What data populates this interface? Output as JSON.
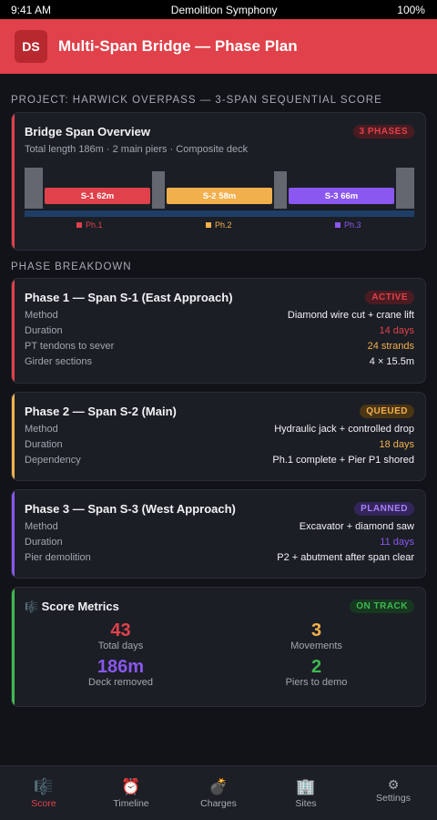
{
  "status": {
    "time": "9:41 AM",
    "app": "Demolition Symphony",
    "battery": "100%"
  },
  "header": {
    "logo": "DS",
    "title": "Multi-Span Bridge — Phase Plan"
  },
  "project_label": "PROJECT: HARWICK OVERPASS — 3-SPAN SEQUENTIAL SCORE",
  "overview": {
    "title": "Bridge Span Overview",
    "badge": "3 PHASES",
    "subtitle": "Total length 186m · 2 main piers · Composite deck",
    "spans": [
      {
        "label": "S-1 62m",
        "color": "#e0414a"
      },
      {
        "label": "S-2 58m",
        "color": "#f2b04d"
      },
      {
        "label": "S-3 66m",
        "color": "#8a57f0"
      }
    ],
    "legend": [
      {
        "label": "Ph.1",
        "color": "#e0414a"
      },
      {
        "label": "Ph.2",
        "color": "#f2b04d"
      },
      {
        "label": "Ph.3",
        "color": "#8a57f0"
      }
    ]
  },
  "breakdown_label": "PHASE BREAKDOWN",
  "phases": [
    {
      "title": "Phase 1 — Span S-1 (East Approach)",
      "badge": "ACTIVE",
      "color": "#e0414a",
      "rows": [
        {
          "k": "Method",
          "v": "Diamond wire cut + crane lift"
        },
        {
          "k": "Duration",
          "v": "14 days"
        },
        {
          "k": "PT tendons to sever",
          "v": "24 strands"
        },
        {
          "k": "Girder sections",
          "v": "4 × 15.5m"
        }
      ]
    },
    {
      "title": "Phase 2 — Span S-2 (Main)",
      "badge": "QUEUED",
      "color": "#f2b04d",
      "rows": [
        {
          "k": "Method",
          "v": "Hydraulic jack + controlled drop"
        },
        {
          "k": "Duration",
          "v": "18 days"
        },
        {
          "k": "Dependency",
          "v": "Ph.1 complete + Pier P1 shored"
        }
      ]
    },
    {
      "title": "Phase 3 — Span S-3 (West Approach)",
      "badge": "PLANNED",
      "color": "#8a57f0",
      "rows": [
        {
          "k": "Method",
          "v": "Excavator + diamond saw"
        },
        {
          "k": "Duration",
          "v": "11 days"
        },
        {
          "k": "Pier demolition",
          "v": "P2 + abutment after span clear"
        }
      ]
    }
  ],
  "metrics": {
    "icon": "🎼",
    "title": "Score Metrics",
    "badge": "ON TRACK",
    "items": [
      {
        "value": "43",
        "label": "Total days",
        "color": "#e0414a"
      },
      {
        "value": "3",
        "label": "Movements",
        "color": "#f2b04d"
      },
      {
        "value": "186m",
        "label": "Deck removed",
        "color": "#8a57f0"
      },
      {
        "value": "2",
        "label": "Piers to demo",
        "color": "#3fb950"
      }
    ]
  },
  "tabs": [
    {
      "icon": "🎼",
      "label": "Score"
    },
    {
      "icon": "⏰",
      "label": "Timeline"
    },
    {
      "icon": "💣",
      "label": "Charges"
    },
    {
      "icon": "🏢",
      "label": "Sites"
    },
    {
      "icon": "⚙",
      "label": "Settings"
    }
  ]
}
